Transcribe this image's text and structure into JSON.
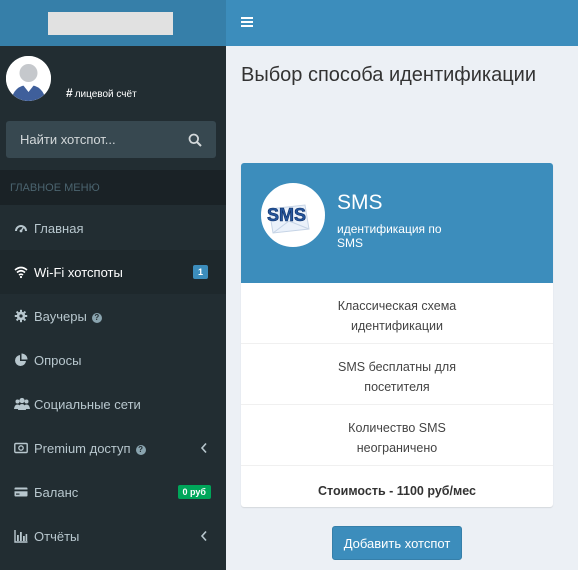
{
  "sidebar": {
    "account_label": "лицевой счёт",
    "search": {
      "placeholder": "Найти хотспот..."
    },
    "menu_header": "ГЛАВНОЕ МЕНЮ",
    "items": [
      {
        "label": "Главная",
        "icon": "dashboard-icon"
      },
      {
        "label": "Wi-Fi хотспоты",
        "icon": "wifi-icon",
        "badge": "1",
        "active": true
      },
      {
        "label": "Ваучеры",
        "icon": "gear-icon",
        "help": true
      },
      {
        "label": "Опросы",
        "icon": "pie-chart-icon"
      },
      {
        "label": "Социальные сети",
        "icon": "users-icon"
      },
      {
        "label": "Premium доступ",
        "icon": "premium-icon",
        "help": true,
        "expandable": true
      },
      {
        "label": "Баланс",
        "icon": "credit-card-icon",
        "badge": "0 руб"
      },
      {
        "label": "Отчёты",
        "icon": "bar-chart-icon",
        "expandable": true
      }
    ]
  },
  "main": {
    "title": "Выбор способа идентификации",
    "card": {
      "logo_text": "SMS",
      "title": "SMS",
      "subtitle": "идентификация по SMS",
      "features": [
        "Классическая схема идентификации",
        "SMS бесплатны для посетителя",
        "Количество SMS неограничено"
      ],
      "price": "Стоимость - 1100 руб/мес"
    },
    "add_button": "Добавить хотспот"
  },
  "colors": {
    "accent": "#3c8dbc",
    "sidebar_bg": "#222d32",
    "success": "#00a65a"
  }
}
